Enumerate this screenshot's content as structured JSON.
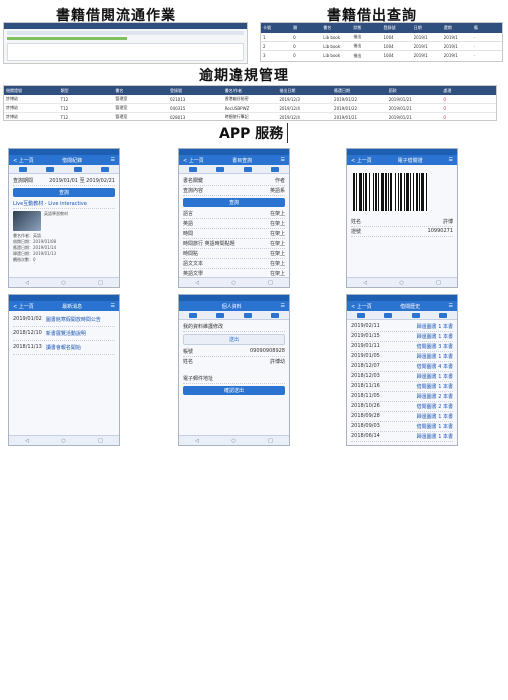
{
  "titles": {
    "circulation": "書籍借閱流通作業",
    "inquiry": "書籍借出查詢",
    "overdue": "逾期違規管理",
    "app": "APP 服務"
  },
  "overdue_table": {
    "headers": [
      "借閱證號",
      "類型",
      "書名",
      "登錄號",
      "書名/作者",
      "借出日期",
      "應還日期",
      "罰款",
      "處理"
    ],
    "rows": [
      [
        "許博幼",
        "T12",
        "管理室",
        "021013",
        "香港幽谷秘密",
        "2019/12/3",
        "2019/01/22",
        "2019/01/21",
        "0"
      ],
      [
        "許博幼",
        "T12",
        "管理室",
        "040315",
        "RecUSBPWZ",
        "2019/12/4",
        "2019/01/22",
        "2019/01/21",
        "0"
      ],
      [
        "許博幼",
        "T12",
        "管理室",
        "028013",
        "時間旅行筆記",
        "2019/12/4",
        "2019/01/21",
        "2019/01/21",
        "0"
      ]
    ]
  },
  "phones": {
    "p1": {
      "nav_title": "借閱紀錄",
      "back": "< 上一頁",
      "date_label": "查詢期間",
      "date_value": "2019/01/01 至 2019/02/21",
      "button": "查詢",
      "book_title": "Live互動教材 - Live interactive",
      "book_sub": "英語學習教材",
      "details": [
        "書名作者：英語",
        "借閱日期：2019/01/08",
        "應還日期：2019/01/14",
        "歸還日期：2019/01/13",
        "續借次數：0"
      ]
    },
    "p2": {
      "nav_title": "書目查詢",
      "back": "< 上一頁",
      "rows": [
        [
          "書名關鍵",
          "作者"
        ],
        [
          "查詢內容",
          "英語系"
        ]
      ],
      "button": "查詢",
      "list": [
        [
          "語言",
          "在架上"
        ],
        [
          "英語",
          "在架上"
        ],
        [
          "時間",
          "在架上"
        ],
        [
          "時間旅行 英語時間點題",
          "在架上"
        ],
        [
          "時間點",
          "在架上"
        ],
        [
          "語文文本",
          "在架上"
        ],
        [
          "英語文學",
          "在架上"
        ],
        [
          "語文文化",
          "在架上"
        ],
        [
          "英語文本",
          "在架上"
        ],
        [
          "第一本書",
          "在架上"
        ]
      ]
    },
    "p3": {
      "nav_title": "電子借閱證",
      "back": "< 上一頁",
      "name_label": "姓名",
      "name_value": "許博",
      "id_label": "證號",
      "id_value": "10990271"
    },
    "p4": {
      "nav_title": "最新消息",
      "back": "< 上一頁",
      "items": [
        [
          "2019/01/02",
          "圖書館寒假開放時間公告"
        ],
        [
          "2018/12/10",
          "新書展覽活動說明"
        ],
        [
          "2018/11/13",
          "讀書會報名開始"
        ]
      ]
    },
    "p5": {
      "nav_title": "個人資料",
      "header": "我的資料維護修改",
      "button": "送出",
      "id_label": "帳號",
      "id_value": "09090908928",
      "name_label": "姓名",
      "name_value": "許博幼",
      "extra_label": "電子郵件地址",
      "submit": "確認送出"
    },
    "p6": {
      "nav_title": "借閱歷史",
      "back": "< 上一頁",
      "history": [
        [
          "2019/02/11",
          "歸還圖書 1 本書"
        ],
        [
          "2019/01/15",
          "歸還圖書 1 本書"
        ],
        [
          "2019/01/11",
          "借閱圖書 3 本書"
        ],
        [
          "2019/01/05",
          "歸還圖書 1 本書"
        ],
        [
          "2018/12/07",
          "借閱圖書 4 本書"
        ],
        [
          "2018/12/03",
          "歸還圖書 1 本書"
        ],
        [
          "2018/11/16",
          "借閱圖書 1 本書"
        ],
        [
          "2018/11/05",
          "歸還圖書 2 本書"
        ],
        [
          "2018/10/26",
          "借閱圖書 2 本書"
        ],
        [
          "2018/09/28",
          "歸還圖書 1 本書"
        ],
        [
          "2018/09/03",
          "借閱圖書 1 本書"
        ],
        [
          "2018/06/14",
          "歸還圖書 1 本書"
        ]
      ]
    }
  }
}
